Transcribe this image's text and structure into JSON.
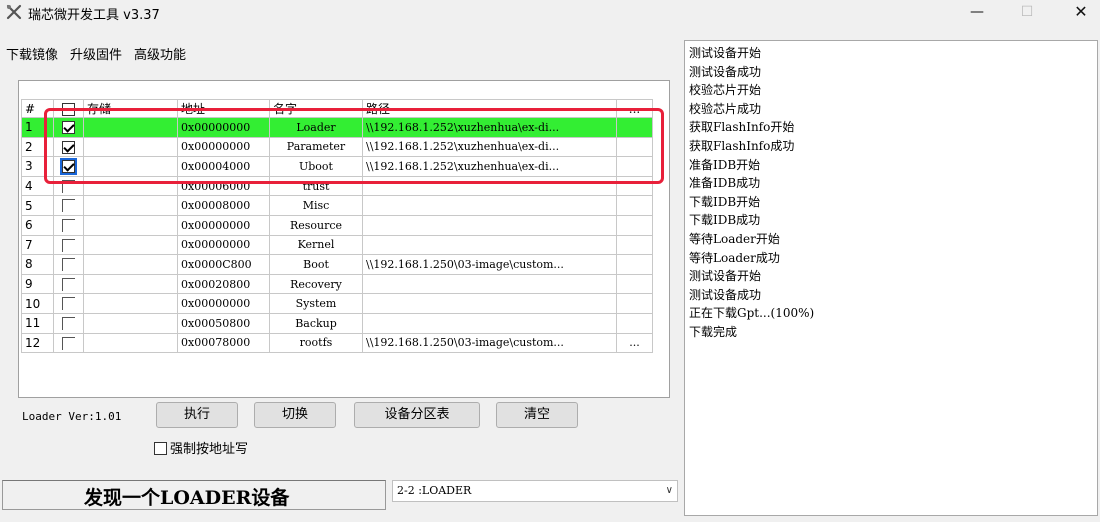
{
  "window": {
    "title": "瑞芯微开发工具 v3.37",
    "min": "—",
    "max": "☐",
    "close": "✕"
  },
  "menu": [
    "下载镜像",
    "升级固件",
    "高级功能"
  ],
  "table": {
    "headers": [
      "#",
      "",
      "存储",
      "地址",
      "名字",
      "路径",
      "..."
    ],
    "rows": [
      {
        "idx": "1",
        "checked": true,
        "addr": "0x00000000",
        "name": "Loader",
        "path": "\\\\192.168.1.252\\xuzhenhua\\ex-di...",
        "more": "",
        "selected": true
      },
      {
        "idx": "2",
        "checked": true,
        "addr": "0x00000000",
        "name": "Parameter",
        "path": "\\\\192.168.1.252\\xuzhenhua\\ex-di...",
        "more": ""
      },
      {
        "idx": "3",
        "checked": true,
        "addr": "0x00004000",
        "name": "Uboot",
        "path": "\\\\192.168.1.252\\xuzhenhua\\ex-di...",
        "more": ""
      },
      {
        "idx": "4",
        "checked": false,
        "addr": "0x00006000",
        "name": "trust",
        "path": "",
        "more": ""
      },
      {
        "idx": "5",
        "checked": false,
        "addr": "0x00008000",
        "name": "Misc",
        "path": "",
        "more": ""
      },
      {
        "idx": "6",
        "checked": false,
        "addr": "0x00000000",
        "name": "Resource",
        "path": "",
        "more": ""
      },
      {
        "idx": "7",
        "checked": false,
        "addr": "0x00000000",
        "name": "Kernel",
        "path": "",
        "more": ""
      },
      {
        "idx": "8",
        "checked": false,
        "addr": "0x0000C800",
        "name": "Boot",
        "path": "\\\\192.168.1.250\\03-image\\custom...",
        "more": ""
      },
      {
        "idx": "9",
        "checked": false,
        "addr": "0x00020800",
        "name": "Recovery",
        "path": "",
        "more": ""
      },
      {
        "idx": "10",
        "checked": false,
        "addr": "0x00000000",
        "name": "System",
        "path": "",
        "more": ""
      },
      {
        "idx": "11",
        "checked": false,
        "addr": "0x00050800",
        "name": "Backup",
        "path": "",
        "more": ""
      },
      {
        "idx": "12",
        "checked": false,
        "addr": "0x00078000",
        "name": "rootfs",
        "path": "\\\\192.168.1.250\\03-image\\custom...",
        "more": "..."
      }
    ]
  },
  "loader_ver": "Loader Ver:1.01",
  "buttons": {
    "execute": "执行",
    "switch": "切换",
    "partition_table": "设备分区表",
    "clear": "清空"
  },
  "force_addr_label": "强制按地址写",
  "status": "发现一个LOADER设备",
  "device": {
    "selected": "2-2 :LOADER"
  },
  "log": [
    "测试设备开始",
    "测试设备成功",
    "校验芯片开始",
    "校验芯片成功",
    "获取FlashInfo开始",
    "获取FlashInfo成功",
    "准备IDB开始",
    "准备IDB成功",
    "下载IDB开始",
    "下载IDB成功",
    "等待Loader开始",
    "等待Loader成功",
    "测试设备开始",
    "测试设备成功",
    "正在下载Gpt...(100%)",
    "下载完成"
  ],
  "colors": {
    "selected_row": "#33ee33",
    "highlight_box": "#e8203a"
  }
}
